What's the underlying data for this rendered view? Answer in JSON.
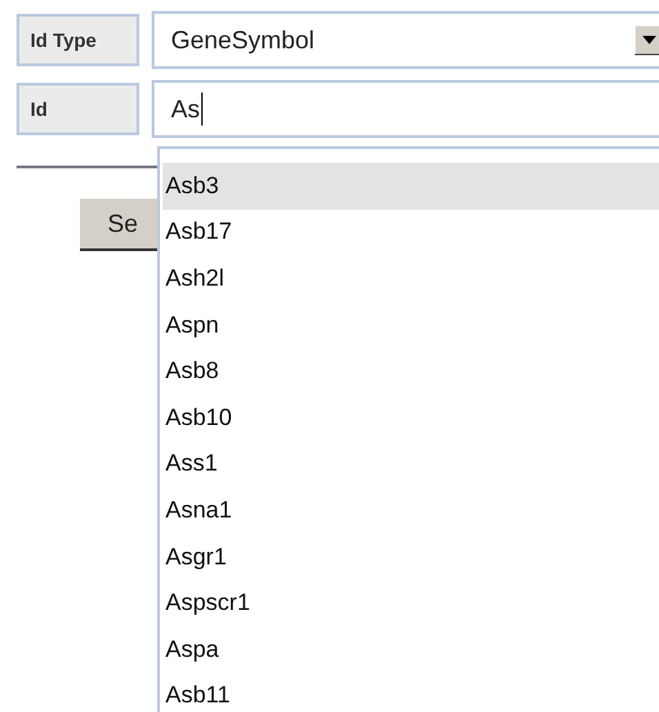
{
  "form": {
    "id_type": {
      "label": "Id Type",
      "value": "GeneSymbol"
    },
    "id": {
      "label": "Id",
      "value": "As"
    },
    "search_button": "Se"
  },
  "suggestions": [
    {
      "text": "Asb3",
      "selected": true
    },
    {
      "text": "Asb17",
      "selected": false
    },
    {
      "text": "Ash2l",
      "selected": false
    },
    {
      "text": "Aspn",
      "selected": false
    },
    {
      "text": "Asb8",
      "selected": false
    },
    {
      "text": "Asb10",
      "selected": false
    },
    {
      "text": "Ass1",
      "selected": false
    },
    {
      "text": "Asna1",
      "selected": false
    },
    {
      "text": "Asgr1",
      "selected": false
    },
    {
      "text": "Aspscr1",
      "selected": false
    },
    {
      "text": "Aspa",
      "selected": false
    },
    {
      "text": "Asb11",
      "selected": false
    }
  ]
}
